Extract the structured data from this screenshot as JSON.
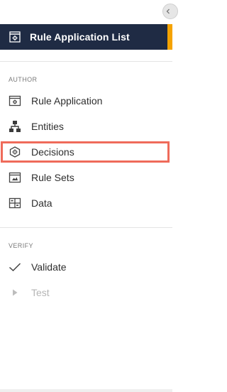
{
  "header": {
    "title": "Rule Application List",
    "icon": "rule-app-list-icon",
    "accent_color": "#f5a300",
    "background_color": "#1f2b44"
  },
  "collapse_button": {
    "icon": "chevron-left-icon"
  },
  "sections": {
    "author": {
      "label": "AUTHOR",
      "items": [
        {
          "label": "Rule Application",
          "icon": "rule-application-icon"
        },
        {
          "label": "Entities",
          "icon": "entities-icon"
        },
        {
          "label": "Decisions",
          "icon": "decisions-icon",
          "highlighted": true
        },
        {
          "label": "Rule Sets",
          "icon": "rule-sets-icon"
        },
        {
          "label": "Data",
          "icon": "data-icon"
        }
      ]
    },
    "verify": {
      "label": "VERIFY",
      "items": [
        {
          "label": "Validate",
          "icon": "checkmark-icon"
        },
        {
          "label": "Test",
          "icon": "play-icon",
          "disabled": true
        }
      ]
    }
  },
  "highlight_color": "#ef6b5a"
}
